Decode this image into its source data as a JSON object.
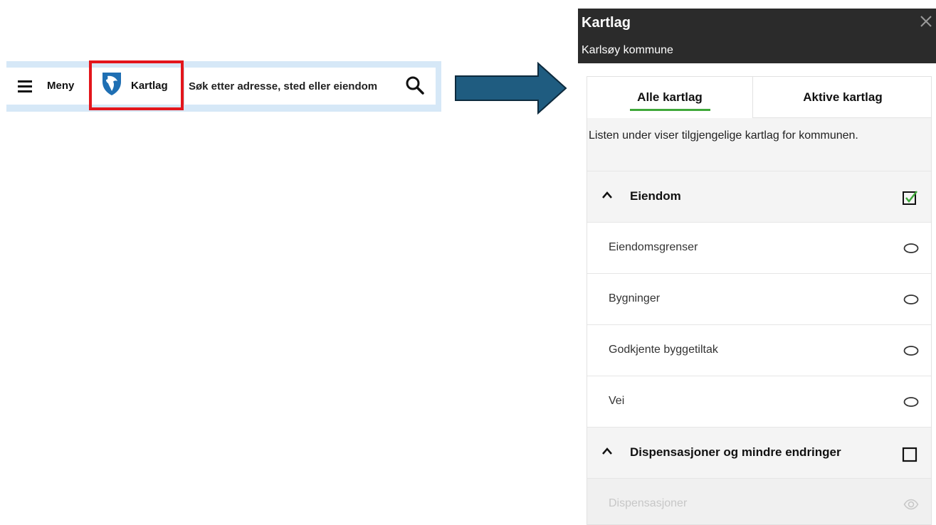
{
  "toolbar": {
    "menu_label": "Meny",
    "kartlag_label": "Kartlag",
    "search_placeholder": "Søk etter adresse, sted eller eiendom",
    "strip_color": "#d6e8f7",
    "highlight_color": "#e3161c"
  },
  "arrow": {
    "color": "#1f5c80"
  },
  "panel": {
    "title": "Kartlag",
    "subtitle": "Karlsøy kommune",
    "tabs": [
      {
        "label": "Alle kartlag",
        "active": true
      },
      {
        "label": "Aktive kartlag",
        "active": false
      }
    ],
    "description": "Listen under viser tilgjengelige kartlag for kommunen.",
    "accent_color": "#3fa83a",
    "groups": [
      {
        "label": "Eiendom",
        "expanded": true,
        "checked": true,
        "layers": [
          {
            "label": "Eiendomsgrenser",
            "icon": "eye-closed-icon",
            "disabled": false
          },
          {
            "label": "Bygninger",
            "icon": "eye-closed-icon",
            "disabled": false
          },
          {
            "label": "Godkjente byggetiltak",
            "icon": "eye-closed-icon",
            "disabled": false
          },
          {
            "label": "Vei",
            "icon": "eye-closed-icon",
            "disabled": false
          }
        ]
      },
      {
        "label": "Dispensasjoner og mindre endringer",
        "expanded": true,
        "checked": false,
        "layers": [
          {
            "label": "Dispensasjoner",
            "icon": "eye-icon",
            "disabled": true
          }
        ]
      }
    ]
  }
}
